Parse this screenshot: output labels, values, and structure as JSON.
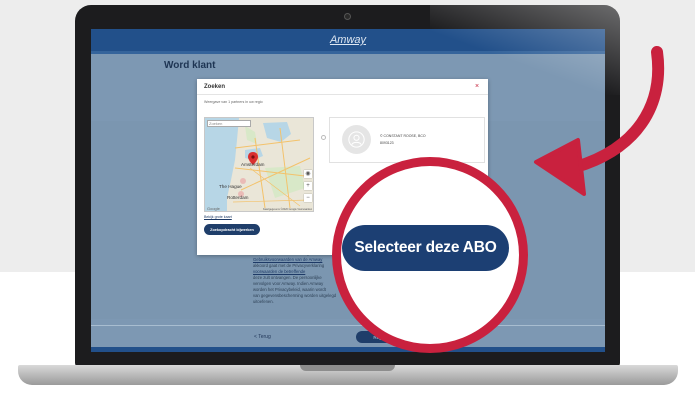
{
  "header": {
    "logo": "Amway"
  },
  "page": {
    "title": "Word klant",
    "form_text_lines": [
      "Door dit formulier naar Amway te",
      "Gebruiksvoorwaarden van de Amway",
      "akkoord gaat met de Privacyverklaring",
      "voorwaarden de betreffende",
      "deze zult ontvangen. De persoonlijke",
      "vervolgen voor Amway. Indien Amway",
      "worden het Privacybeleid, waarin wordt",
      "van gegevensbescherming worden uitgelegd",
      "uitoefenen."
    ],
    "back_link": "< Terug",
    "register_button": "Registreren"
  },
  "modal": {
    "title": "Zoeken",
    "close_icon": "×",
    "hint": "Weergave van 1 partners in uw regio",
    "map": {
      "search_placeholder": "Zoeken",
      "labels": [
        "Amsterdam",
        "The Hague",
        "Rotterdam"
      ],
      "google": "Google",
      "attribution": "Kaartgegevens ©2020 Google  Voorwaarden",
      "zoom_in": "+",
      "zoom_out": "−"
    },
    "map_link": "Bekijk grote kaart",
    "search_button": "Zoekopdracht bijwerken",
    "result": {
      "name": "© CONSTANT ROOSE, BCO",
      "id": "8093123"
    }
  },
  "callout": {
    "select_button": "Selecteer deze ABO",
    "accent_color": "#c9213e",
    "button_color": "#1c3f73"
  }
}
